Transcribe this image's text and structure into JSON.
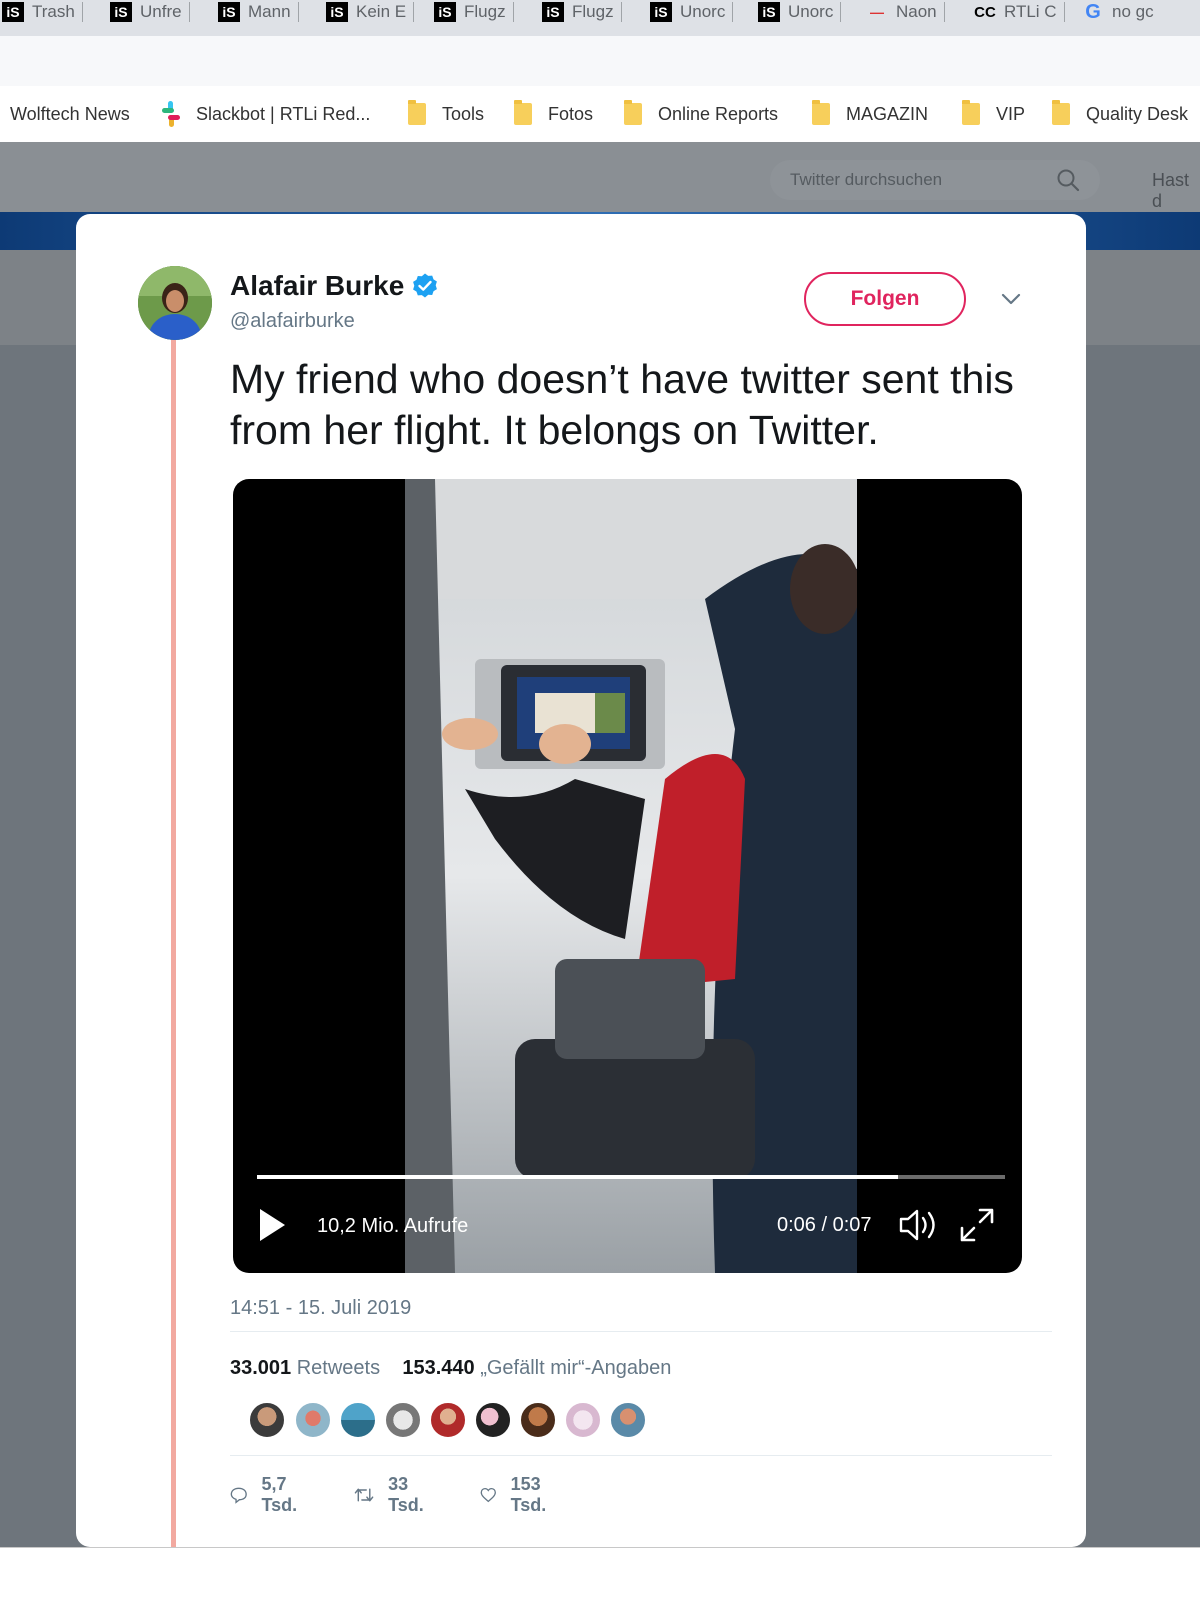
{
  "browser": {
    "tabs": [
      {
        "label": "Trash",
        "icon": "is-icon"
      },
      {
        "label": "Unfre",
        "icon": "is-icon"
      },
      {
        "label": "Mann",
        "icon": "is-icon"
      },
      {
        "label": "Kein E",
        "icon": "is-icon"
      },
      {
        "label": "Flugz",
        "icon": "is-icon"
      },
      {
        "label": "Flugz",
        "icon": "is-icon"
      },
      {
        "label": "Unorc",
        "icon": "is-icon"
      },
      {
        "label": "Unorc",
        "icon": "is-icon"
      },
      {
        "label": "Naon",
        "icon": "news-icon"
      },
      {
        "label": "RTLi C",
        "icon": "cc-icon"
      },
      {
        "label": "no gc",
        "icon": "google-icon"
      }
    ],
    "bookmarks": [
      {
        "label": "Wolftech News",
        "icon": "none"
      },
      {
        "label": "Slackbot | RTLi Red...",
        "icon": "slack-icon"
      },
      {
        "label": "Tools",
        "icon": "folder-icon"
      },
      {
        "label": "Fotos",
        "icon": "folder-icon"
      },
      {
        "label": "Online Reports",
        "icon": "folder-icon"
      },
      {
        "label": "MAGAZIN",
        "icon": "folder-icon"
      },
      {
        "label": "VIP",
        "icon": "folder-icon"
      },
      {
        "label": "Quality Desk",
        "icon": "folder-icon"
      }
    ]
  },
  "twitter": {
    "search_placeholder": "Twitter durchsuchen",
    "right_hint": "Hast d"
  },
  "tweet": {
    "author_name": "Alafair Burke",
    "author_handle": "@alafairburke",
    "follow_label": "Folgen",
    "text": "My friend who doesn’t have twitter sent this from her flight. It belongs on Twitter.",
    "timestamp": "14:51 - 15. Juli 2019",
    "retweets_count": "33.001",
    "retweets_label": "Retweets",
    "likes_count": "153.440",
    "likes_label": "„Gefällt mir“-Angaben",
    "replies_short": "5,7 Tsd.",
    "retweets_short": "33 Tsd.",
    "likes_short": "153 Tsd."
  },
  "video": {
    "views": "10,2 Mio. Aufrufe",
    "time": "0:06 / 0:07",
    "progress": 0.857
  },
  "colors": {
    "accent": "#e0245e",
    "verified": "#1da1f2",
    "thread_line": "#f2a9a0"
  }
}
